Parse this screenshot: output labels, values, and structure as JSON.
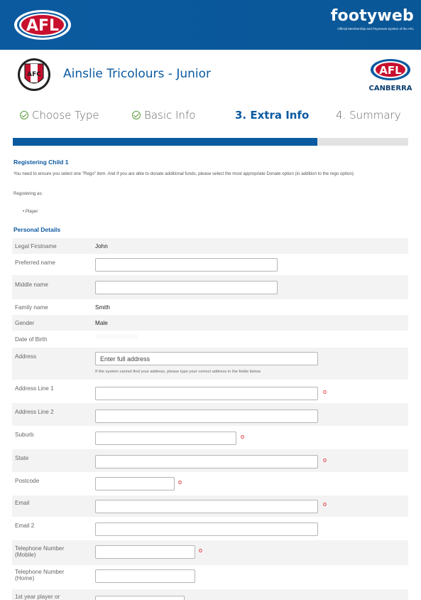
{
  "header": {
    "afl_logo_text": "AFL",
    "brand": "footyweb",
    "tagline": "Official Membership and Payments System of the AFL"
  },
  "club": {
    "name": "Ainslie Tricolours - Junior",
    "logo_text": "AFC",
    "partner_logo_text": "AFL",
    "partner_logo_sub": "CANBERRA"
  },
  "steps": [
    {
      "label": "Choose Type",
      "state": "done"
    },
    {
      "label": "Basic Info",
      "state": "done"
    },
    {
      "label": "3. Extra Info",
      "state": "active"
    },
    {
      "label": "4. Summary",
      "state": "pending"
    }
  ],
  "progress_fraction": 0.77,
  "registering": {
    "heading": "Registering Child 1",
    "instructions": "You need to ensure you select one \"Rego\" item. And if you are able to donate additional funds, please select the most appropriate Donate option (in addition to the rego option).",
    "registering_as_label": "Registering as:",
    "roles": [
      "Player"
    ]
  },
  "personal": {
    "heading": "Personal Details",
    "legal_firstname": {
      "label": "Legal Firstname",
      "value": "John"
    },
    "preferred_name": {
      "label": "Preferred name",
      "value": ""
    },
    "middle_name": {
      "label": "Middle name",
      "value": ""
    },
    "family_name": {
      "label": "Family name",
      "value": "Smith"
    },
    "gender": {
      "label": "Gender",
      "value": "Male"
    },
    "dob": {
      "label": "Date of Birth",
      "value": ""
    },
    "address": {
      "label": "Address",
      "placeholder": "Enter full address",
      "hint": "If the system cannot find your address, please type your correct address in the fields below"
    },
    "address1": {
      "label": "Address Line 1",
      "value": ""
    },
    "address2": {
      "label": "Address Line 2",
      "value": ""
    },
    "suburb": {
      "label": "Suburb",
      "value": ""
    },
    "state": {
      "label": "State",
      "value": ""
    },
    "postcode": {
      "label": "Postcode",
      "value": ""
    },
    "email": {
      "label": "Email",
      "value": ""
    },
    "email2": {
      "label": "Email 2",
      "value": ""
    },
    "tel_mobile": {
      "label": "Telephone Number (Mobile)",
      "value": ""
    },
    "tel_home": {
      "label": "Telephone Number (Home)",
      "value": ""
    },
    "first_year": {
      "label": "1st year player or",
      "value": ""
    }
  },
  "required_marker": "o",
  "colors": {
    "brand_blue": "#0b5aa0",
    "required": "#dd2222",
    "check_green": "#5a9a3a"
  }
}
